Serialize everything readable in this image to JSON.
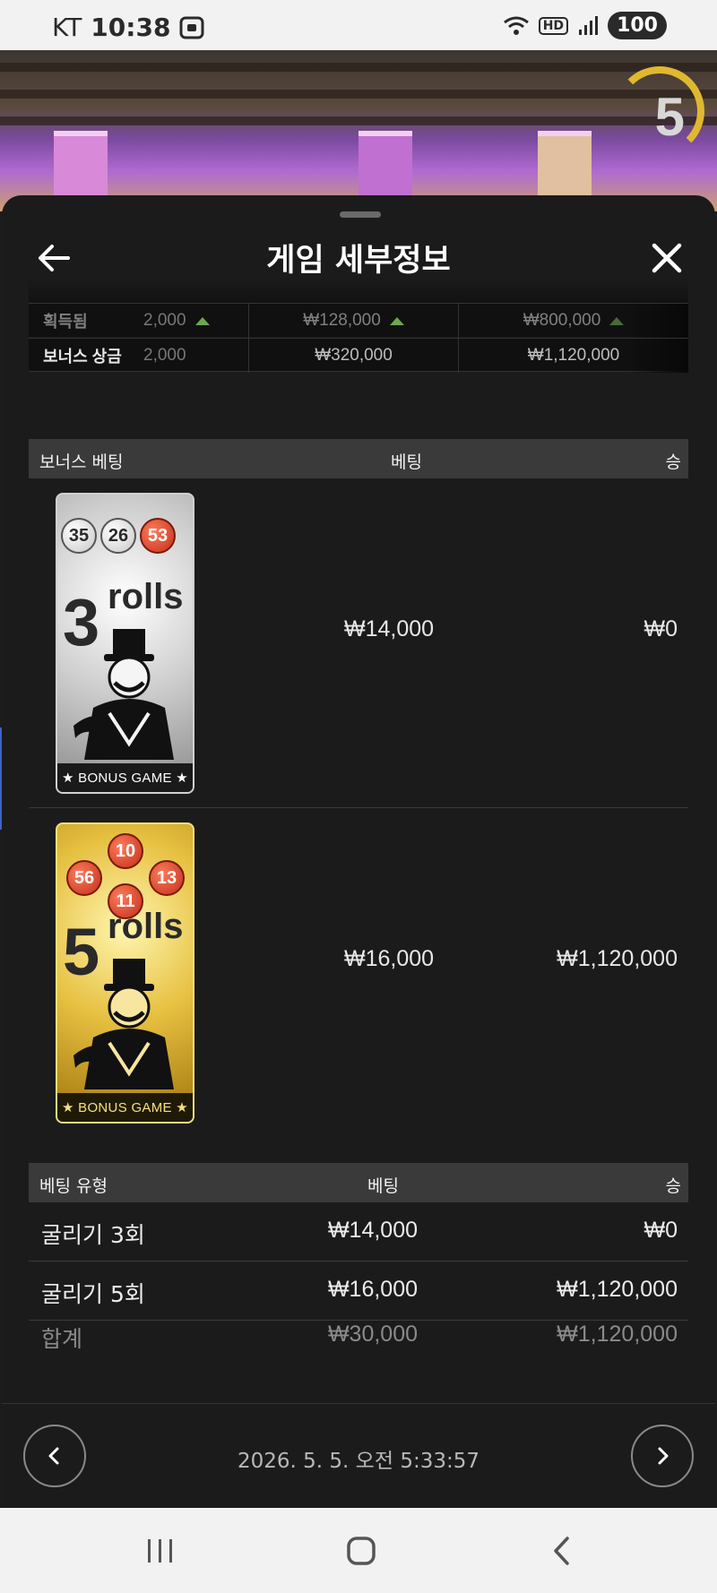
{
  "status_bar": {
    "carrier": "KT",
    "time": "10:38",
    "network": "HD",
    "battery": "100"
  },
  "game": {
    "timer": "5"
  },
  "sheet": {
    "title": "게임 세부정보"
  },
  "summary": {
    "rows": [
      {
        "label": "획득됨",
        "c0": "2,000",
        "c1": "₩128,000",
        "c2": "₩800,000"
      },
      {
        "label": "보너스 상금",
        "c0": "2,000",
        "c1": "₩320,000",
        "c2": "₩1,120,000"
      }
    ]
  },
  "bonus_table": {
    "headers": [
      "보너스 베팅",
      "베팅",
      "승"
    ],
    "rows": [
      {
        "card": {
          "rolls": "3",
          "word": "rolls",
          "balls": [
            "35",
            "26",
            "53"
          ],
          "footer": "★ BONUS GAME ★"
        },
        "bet": "₩14,000",
        "win": "₩0"
      },
      {
        "card": {
          "rolls": "5",
          "word": "rolls",
          "balls": [
            "10",
            "56",
            "13",
            "11"
          ],
          "footer": "★ BONUS GAME ★"
        },
        "bet": "₩16,000",
        "win": "₩1,120,000"
      }
    ]
  },
  "bet_types": {
    "headers": [
      "베팅 유형",
      "베팅",
      "승"
    ],
    "rows": [
      {
        "name": "굴리기 3회",
        "bet": "₩14,000",
        "win": "₩0"
      },
      {
        "name": "굴리기 5회",
        "bet": "₩16,000",
        "win": "₩1,120,000"
      },
      {
        "name": "합계",
        "bet": "₩30,000",
        "win": "₩1,120,000"
      }
    ]
  },
  "footer": {
    "date": "2026. 5. 5. 오전 5:33:57"
  },
  "colors": {
    "sheet_bg": "#1b1b1b",
    "header_bg": "#3a3a3a",
    "side_tab": "#3d63c8",
    "timer_ring": "#e0b830"
  }
}
